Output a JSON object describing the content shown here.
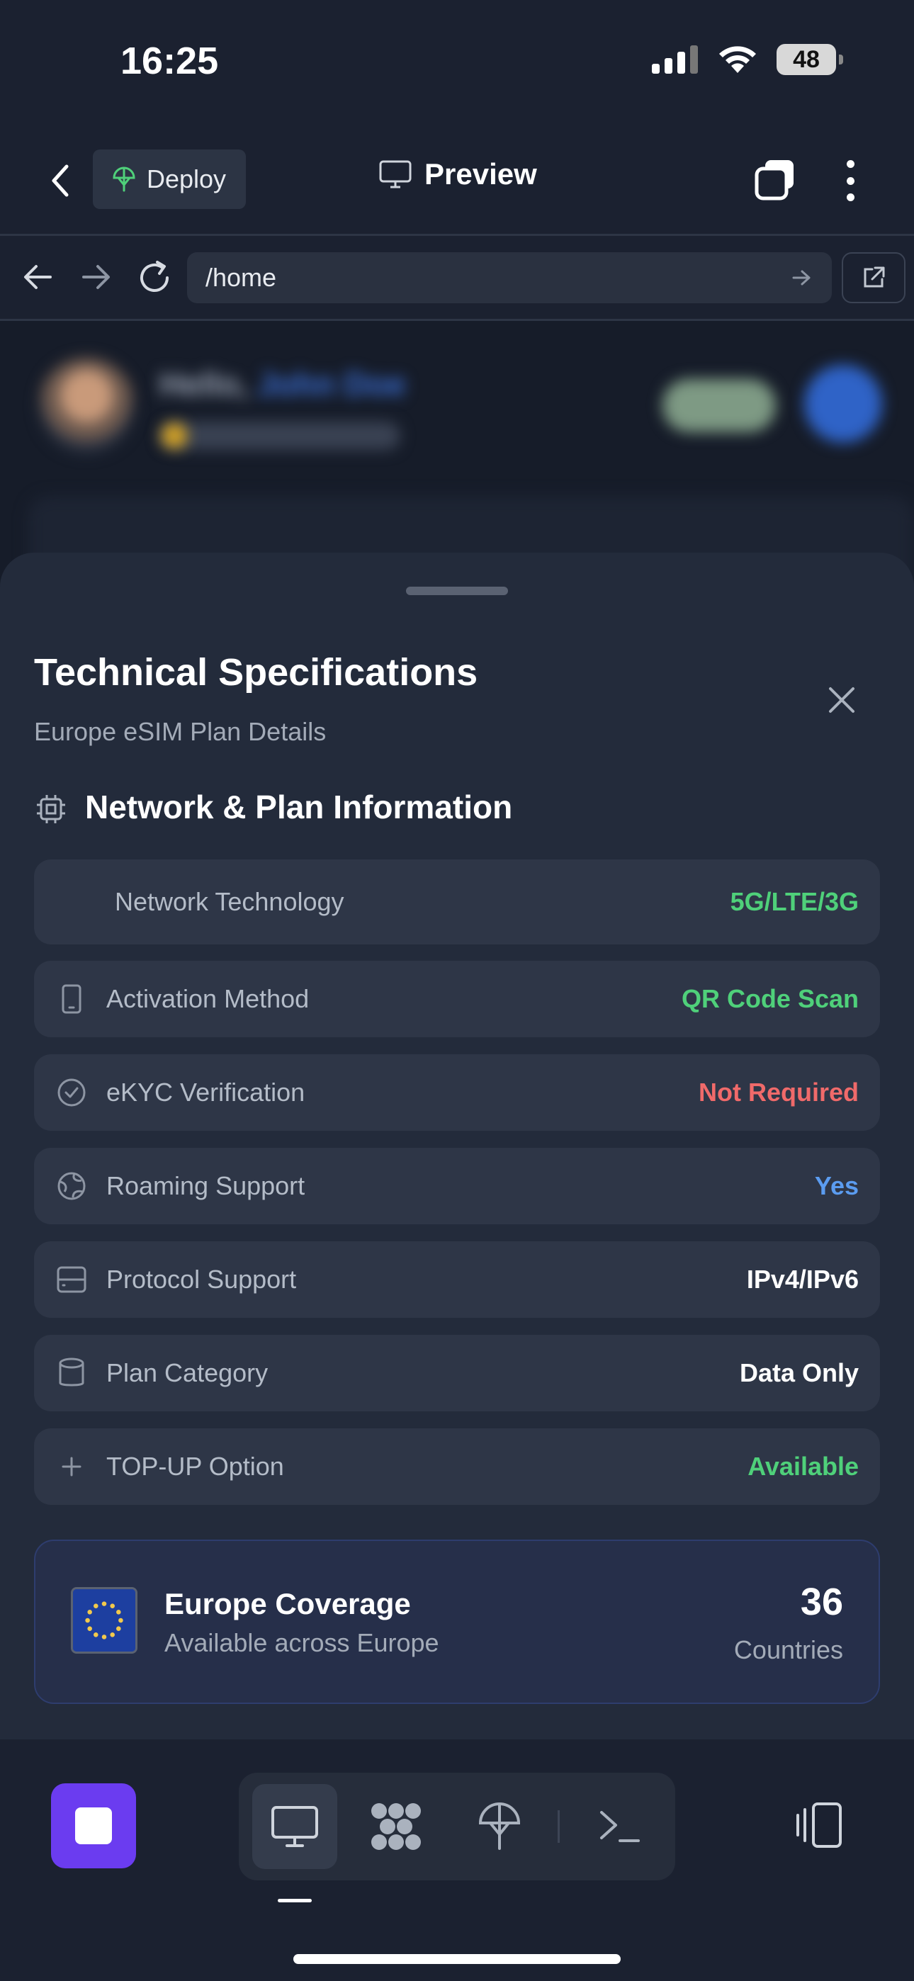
{
  "status_bar": {
    "time": "16:25",
    "battery": "48"
  },
  "app_header": {
    "deploy_label": "Deploy",
    "preview_label": "Preview"
  },
  "browser": {
    "url": "/home"
  },
  "background_page": {
    "greeting": "Hello, ",
    "name": "John Doe"
  },
  "sheet": {
    "title": "Technical Specifications",
    "subtitle": "Europe eSIM Plan Details",
    "section_title": "Network & Plan Information",
    "specs": [
      {
        "label": "Network Technology",
        "value": "5G/LTE/3G",
        "color": "#4fd07a",
        "icon": "none"
      },
      {
        "label": "Activation Method",
        "value": "QR Code Scan",
        "color": "#4fd07a",
        "icon": "phone-icon"
      },
      {
        "label": "eKYC Verification",
        "value": "Not Required",
        "color": "#f06a6a",
        "icon": "check-circle-icon"
      },
      {
        "label": "Roaming Support",
        "value": "Yes",
        "color": "#5b9cf0",
        "icon": "globe-icon"
      },
      {
        "label": "Protocol Support",
        "value": "IPv4/IPv6",
        "color": "#ffffff",
        "icon": "server-icon"
      },
      {
        "label": "Plan Category",
        "value": "Data Only",
        "color": "#ffffff",
        "icon": "database-icon"
      },
      {
        "label": "TOP-UP Option",
        "value": "Available",
        "color": "#4fd07a",
        "icon": "plus-icon"
      }
    ],
    "coverage": {
      "title": "Europe Coverage",
      "subtitle": "Available across Europe",
      "count": "36",
      "unit": "Countries"
    }
  },
  "colors": {
    "accent_purple": "#6b3cf0",
    "sheet_bg": "#232b3b",
    "row_bg": "#2e3647"
  }
}
